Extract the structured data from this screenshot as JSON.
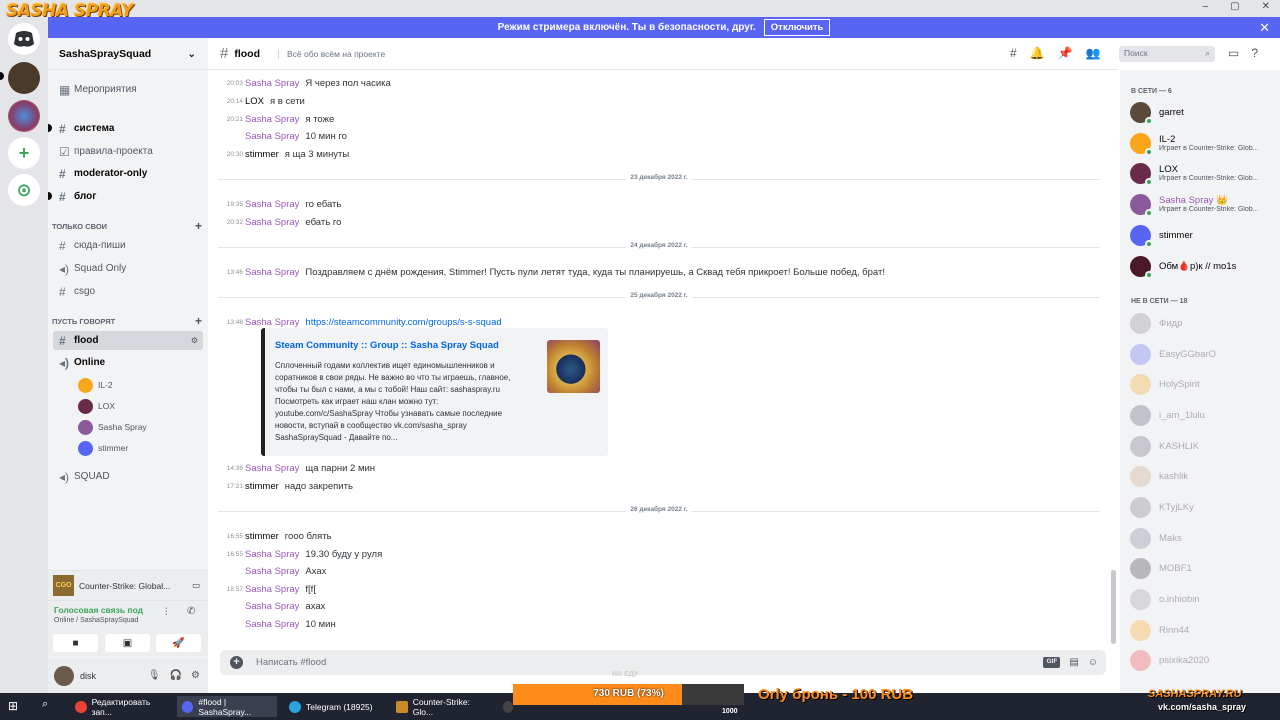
{
  "colors": {
    "accent": "#5865f2",
    "sasha": "#9b59b6",
    "online": "#3ba55d",
    "link": "#0067e0",
    "overlay": "#ff8c1a"
  },
  "brand": {
    "logo": "SASHA SPRAY"
  },
  "streamer_bar": {
    "text": "Режим стримера включён. Ты в безопасности, друг.",
    "button": "Отключить",
    "close": "✕"
  },
  "window": {
    "minimize": "–",
    "maximize": "▢",
    "close": "✕"
  },
  "guilds": {
    "add": "+",
    "explore": "⊙"
  },
  "sidebar": {
    "server_name": "SashaSpraySquad",
    "events": "Мероприятия",
    "channels": [
      {
        "name": "система",
        "bold": true
      },
      {
        "name": "правила-проекта",
        "bold": false
      },
      {
        "name": "moderator-only",
        "bold": true
      },
      {
        "name": "блог",
        "bold": true
      }
    ],
    "category1": "ТОЛЬКО СВОИ",
    "channels2": [
      "сюда-пиши",
      "Squad Only",
      "csgo"
    ],
    "category2": "ПУСТЬ ГОВОРЯТ",
    "selected_channel": "flood",
    "voice_channel": "Online",
    "voice_users": [
      "IL-2",
      "LOX",
      "Sasha Spray",
      "stimmer"
    ],
    "squad_channel": "SQUAD"
  },
  "activity": {
    "icon_text": "CGO",
    "game": "Counter-Strike: Global..."
  },
  "voice": {
    "title": "Голосовая связь под",
    "subtitle": "Online / SashaSpraySquad"
  },
  "user": {
    "name": "disk"
  },
  "chat": {
    "channel": "flood",
    "topic": "Всё обо всём на проекте",
    "search_placeholder": "Поиск",
    "messages": [
      {
        "ts": "20:03",
        "author": "Sasha Spray",
        "text": "Я через пол часика"
      },
      {
        "ts": "20:14",
        "author": "LOX",
        "text": "я в сети"
      },
      {
        "ts": "20:21",
        "author": "Sasha Spray",
        "text": "я тоже"
      },
      {
        "ts": "",
        "author": "Sasha Spray",
        "text": "10 мин го"
      },
      {
        "ts": "20:30",
        "author": "stimmer",
        "text": "я ща 3 минуты"
      },
      {
        "ts": "19:35",
        "author": "Sasha Spray",
        "text": "го ебать"
      },
      {
        "ts": "20:32",
        "author": "Sasha Spray",
        "text": "ебать го"
      },
      {
        "ts": "13:46",
        "author": "Sasha Spray",
        "text": "Поздравляем с днём рождения, Stimmer! Пусть пули летят туда, куда ты планируешь, а Сквад тебя прикроет! Больше побед, брат!"
      },
      {
        "ts": "13:48",
        "author": "Sasha Spray",
        "text": "https://steamcommunity.com/groups/s-s-squad"
      },
      {
        "ts": "14:36",
        "author": "Sasha Spray",
        "text": "ща парни 2 мин"
      },
      {
        "ts": "17:21",
        "author": "stimmer",
        "text": "надо закрепить"
      },
      {
        "ts": "16:55",
        "author": "stimmer",
        "text": "гооо блять"
      },
      {
        "ts": "16:55",
        "author": "Sasha Spray",
        "text": "19.30 буду у руля"
      },
      {
        "ts": "",
        "author": "Sasha Spray",
        "text": "Ахах"
      },
      {
        "ts": "18:57",
        "author": "Sasha Spray",
        "text": "f[f["
      },
      {
        "ts": "",
        "author": "Sasha Spray",
        "text": "ахах"
      },
      {
        "ts": "",
        "author": "Sasha Spray",
        "text": "10 мин"
      }
    ],
    "dividers": [
      "23 декабря 2022 г.",
      "24 декабря 2022 г.",
      "25 декабря 2022 г.",
      "26 декабря 2022 г."
    ],
    "embed": {
      "title": "Steam Community :: Group :: Sasha Spray Squad",
      "description": "Сплоченный годами коллектив ищет единомышленников и соратников в свои ряды. Не важно во что ты играешь, главное, чтобы ты был с нами, а мы с тобой! Наш сайт: sashaspray.ru Посмотреть как играет наш клан можно тут: youtube.com/c/SashaSpray Чтобы узнавать самые последние новости, вступай в сообщество vk.com/sasha_spray SashaSpraySquad - Давайте по..."
    },
    "composer_placeholder": "Написать #flood",
    "gif": "GIF"
  },
  "members": {
    "online_header": "В СЕТИ — 6",
    "online": [
      {
        "name": "garret",
        "game": ""
      },
      {
        "name": "IL-2",
        "game": "Играет в Counter-Strike: Glob..."
      },
      {
        "name": "LOX",
        "game": "Играет в Counter-Strike: Glob..."
      },
      {
        "name": "Sasha Spray 👑",
        "game": "Играет в Counter-Strike: Glob..."
      },
      {
        "name": "stimmer",
        "game": ""
      },
      {
        "name": "Обм🩸р)к // mo1s",
        "game": ""
      }
    ],
    "offline_header": "НЕ В СЕТИ — 18",
    "offline": [
      "Фидр",
      "EasyGGbarO",
      "HolySpirit",
      "i_am_1lulu",
      "KASHLIK",
      "kashlik",
      "KTyjLKy",
      "Maks",
      "MOBF1",
      "o.inhiobin",
      "Rinn44",
      "psixika2020"
    ]
  },
  "overlay": {
    "label": "НА ЕДУ",
    "progress_text": "730 RUB (73%)",
    "progress": 0.73,
    "goal": "1000",
    "promo": "Orly бронь - 100 RUB",
    "site1": "SASHASPRAY.RU",
    "site2": "vk.com/sasha_spray"
  },
  "taskbar": {
    "items": [
      "Редактировать зап...",
      "#flood | SashaSpray...",
      "Telegram (18925)",
      "Counter-Strike: Glo...",
      "OBS 28.1.2 (64-bi..."
    ]
  }
}
